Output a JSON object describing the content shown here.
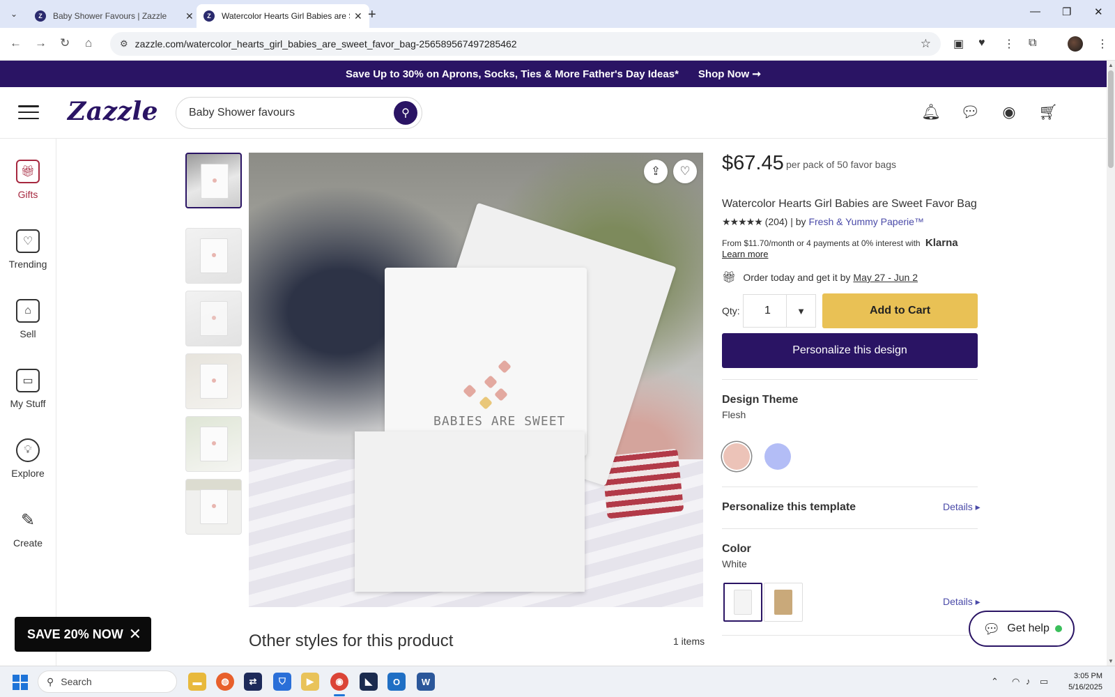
{
  "browser": {
    "tabs": [
      {
        "title": "Baby Shower Favours | Zazzle",
        "active": false
      },
      {
        "title": "Watercolor Hearts Girl Babies are Sweet Favor Bag",
        "active": true
      }
    ],
    "url": "zazzle.com/watercolor_hearts_girl_babies_are_sweet_favor_bag-256589567497285462"
  },
  "promo": {
    "text": "Save Up to 30% on Aprons, Socks, Ties & More Father's Day Ideas*",
    "cta": "Shop Now ➞"
  },
  "header": {
    "logo": "Zazzle",
    "search_value": "Baby Shower favours"
  },
  "rail": {
    "items": [
      {
        "label": "Gifts",
        "icon": "gift-icon"
      },
      {
        "label": "Trending",
        "icon": "trending-icon"
      },
      {
        "label": "Sell",
        "icon": "store-icon"
      },
      {
        "label": "My Stuff",
        "icon": "folder-icon"
      },
      {
        "label": "Explore",
        "icon": "lightbulb-icon"
      },
      {
        "label": "Create",
        "icon": "magic-wand-icon"
      }
    ]
  },
  "product": {
    "image_text": "BABIES ARE SWEET",
    "price": "$67.45",
    "price_note": "per pack of 50 favor bags",
    "title": "Watercolor Hearts Girl Babies are Sweet Favor Bag",
    "stars": "★★★★★",
    "rating_count": "(204)",
    "by_label": "| by",
    "seller": "Fresh & Yummy Paperie™",
    "klarna_text": "From $11.70/month or 4 payments at 0% interest with",
    "klarna_brand": "Klarna",
    "learn_more": "Learn more",
    "delivery_text": "Order today and get it by",
    "delivery_date": "May 27 - Jun 2",
    "qty_label": "Qty:",
    "qty_value": "1",
    "add_to_cart": "Add to Cart",
    "personalize": "Personalize this design",
    "design_theme_label": "Design Theme",
    "design_theme_value": "Flesh",
    "theme_colors": [
      "#ecc3b8",
      "#b3bdf6"
    ],
    "template_label": "Personalize this template",
    "details_label": "Details ▸",
    "color_label": "Color",
    "color_value": "White",
    "other_styles": "Other styles for this product",
    "items_count": "1 items"
  },
  "floating": {
    "save_now": "SAVE 20% NOW",
    "get_help": "Get help"
  },
  "taskbar": {
    "search": "Search",
    "time": "3:05 PM",
    "date": "5/16/2025"
  }
}
